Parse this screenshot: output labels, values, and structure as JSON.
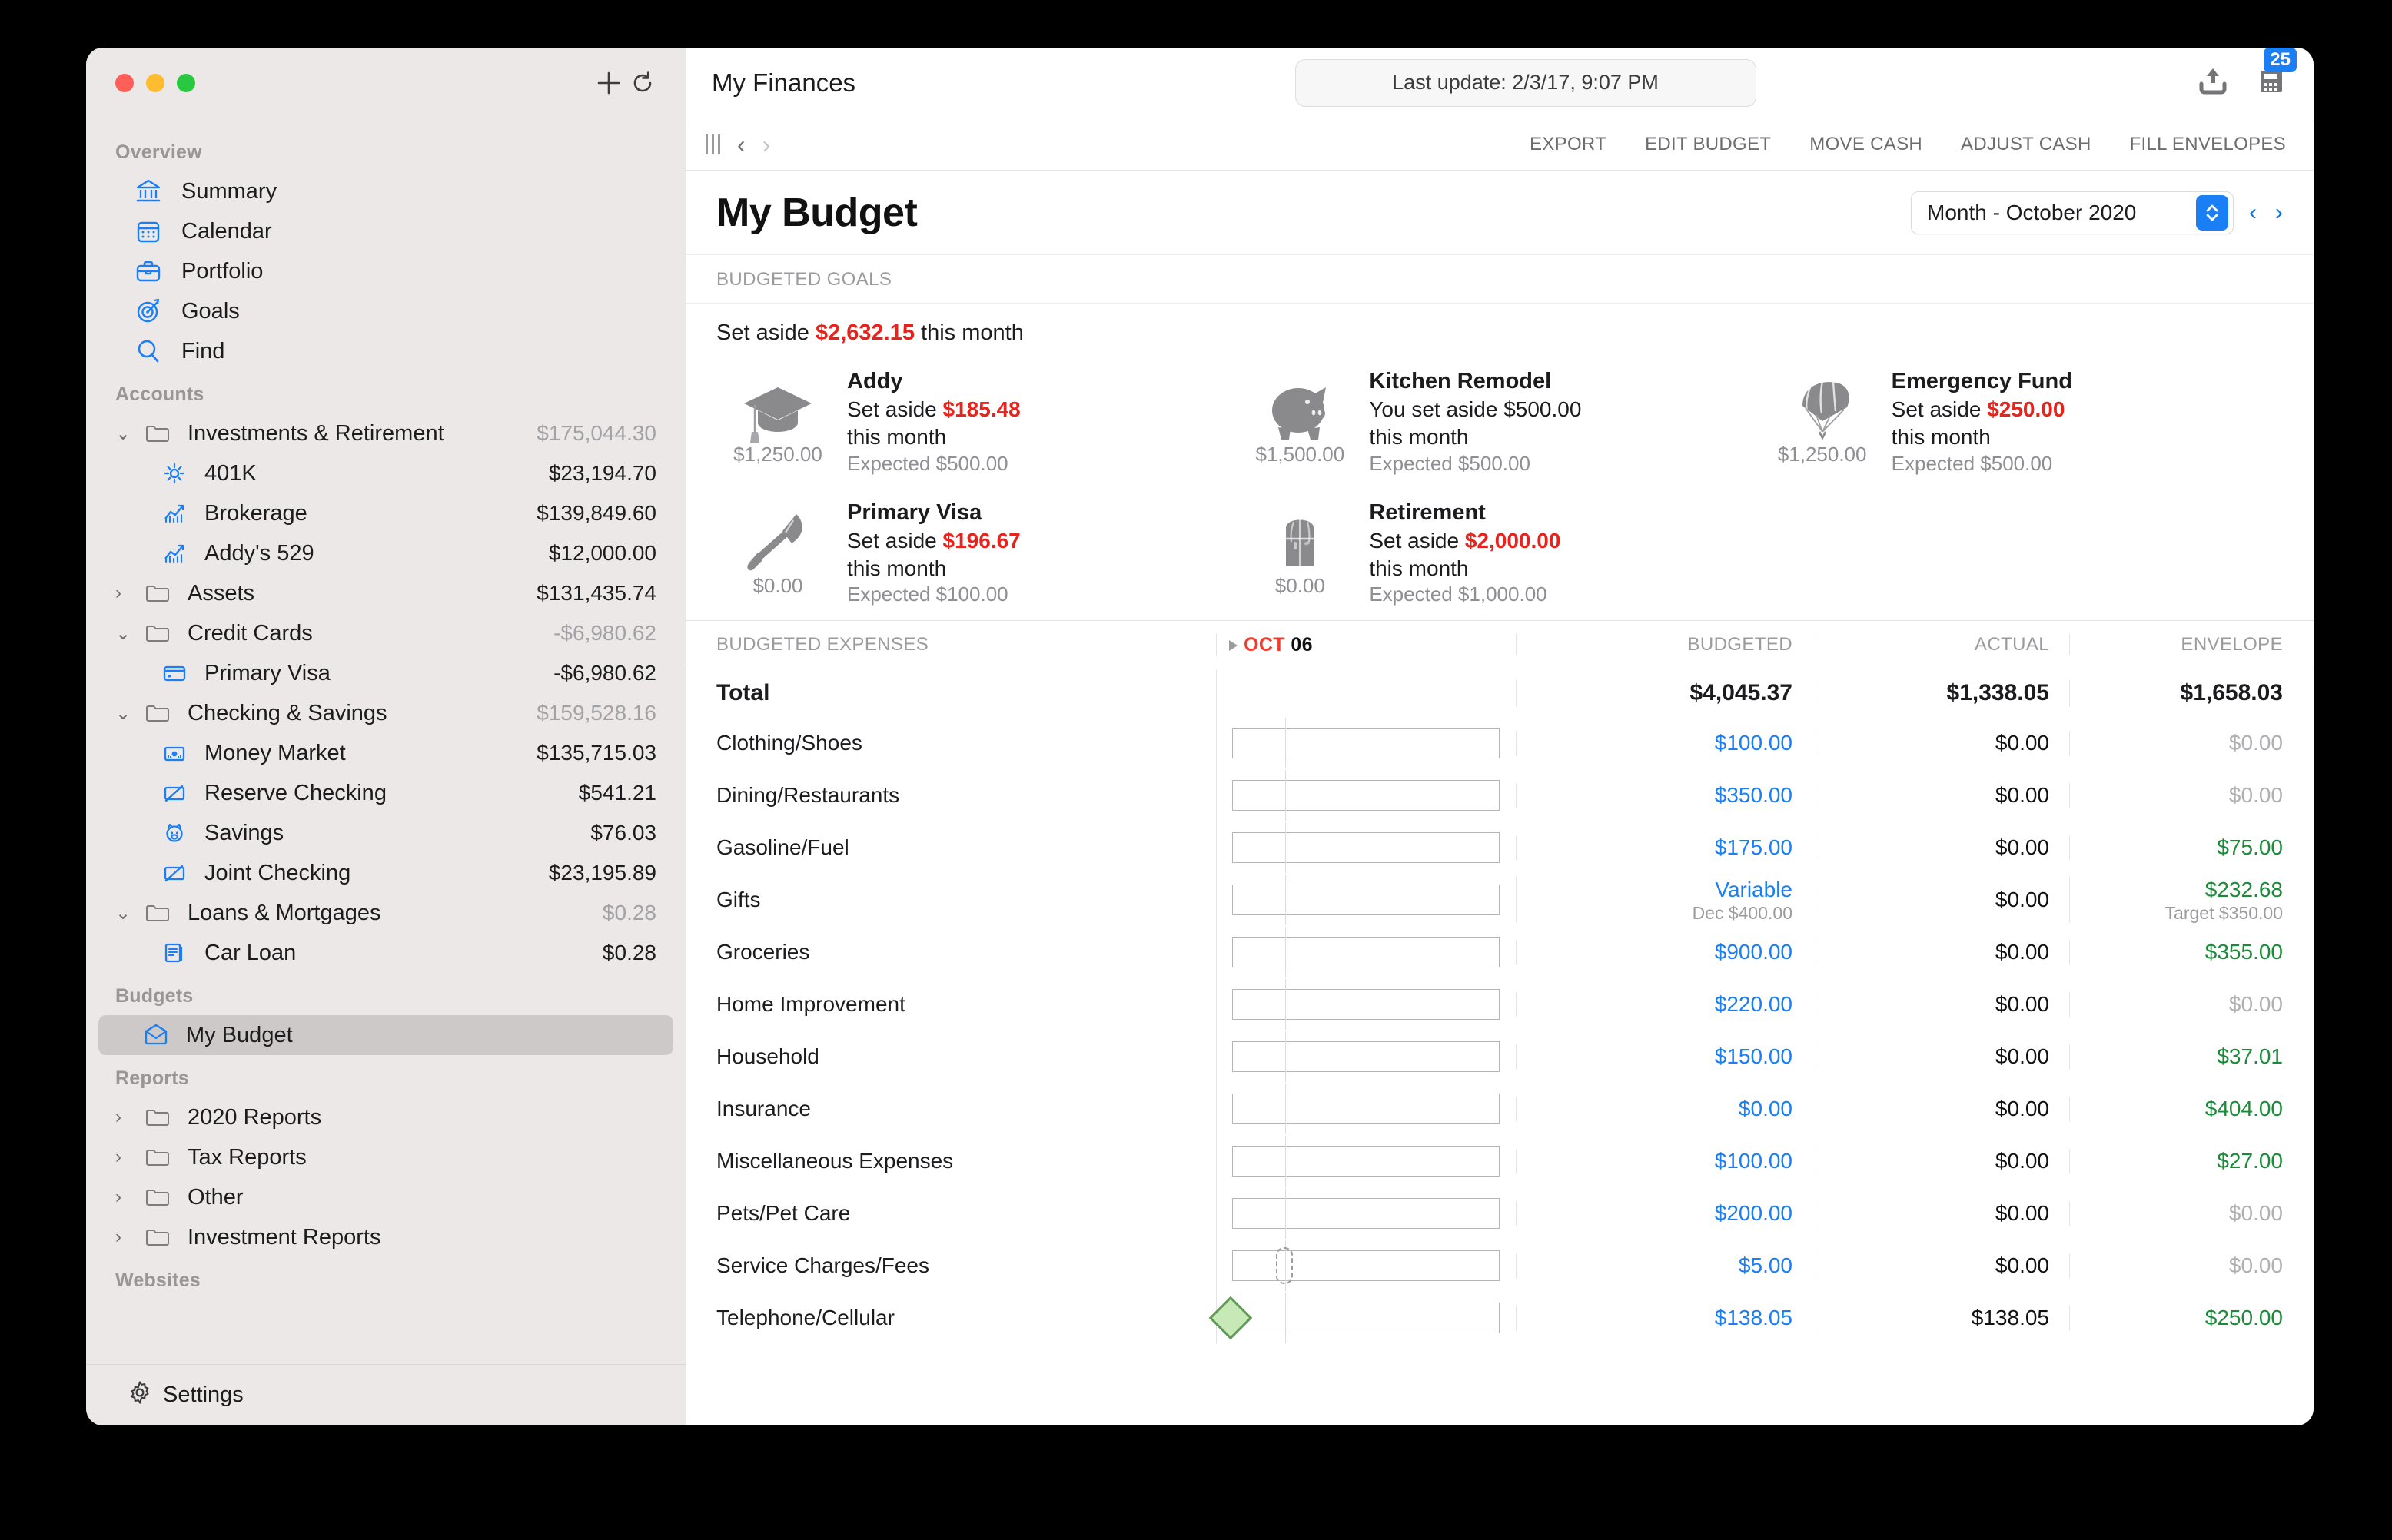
{
  "window": {
    "traffic": [
      "close",
      "minimize",
      "zoom"
    ],
    "sidebar_add_label": "+",
    "sidebar_refresh_label": "refresh"
  },
  "sidebar": {
    "sections": [
      {
        "title": "Overview",
        "items": [
          {
            "label": "Summary",
            "icon": "bank-icon",
            "amount": ""
          },
          {
            "label": "Calendar",
            "icon": "calendar-icon",
            "amount": ""
          },
          {
            "label": "Portfolio",
            "icon": "briefcase-icon",
            "amount": ""
          },
          {
            "label": "Goals",
            "icon": "target-icon",
            "amount": ""
          },
          {
            "label": "Find",
            "icon": "search-icon",
            "amount": ""
          }
        ]
      },
      {
        "title": "Accounts",
        "items": [
          {
            "label": "Investments & Retirement",
            "icon": "folder-icon",
            "amount": "$175,044.30",
            "muted": true,
            "disc": "open",
            "child": false
          },
          {
            "label": "401K",
            "icon": "sun-icon",
            "amount": "$23,194.70",
            "muted": false,
            "disc": "",
            "child": true
          },
          {
            "label": "Brokerage",
            "icon": "chart-up-icon",
            "amount": "$139,849.60",
            "muted": false,
            "disc": "",
            "child": true
          },
          {
            "label": "Addy's 529",
            "icon": "chart-up-icon",
            "amount": "$12,000.00",
            "muted": false,
            "disc": "",
            "child": true
          },
          {
            "label": "Assets",
            "icon": "folder-icon",
            "amount": "$131,435.74",
            "muted": false,
            "disc": "closed",
            "child": false
          },
          {
            "label": "Credit Cards",
            "icon": "folder-icon",
            "amount": "-$6,980.62",
            "muted": true,
            "disc": "open",
            "child": false
          },
          {
            "label": "Primary Visa",
            "icon": "credit-card-icon",
            "amount": "-$6,980.62",
            "muted": false,
            "disc": "",
            "child": true
          },
          {
            "label": "Checking & Savings",
            "icon": "folder-icon",
            "amount": "$159,528.16",
            "muted": true,
            "disc": "open",
            "child": false
          },
          {
            "label": "Money Market",
            "icon": "money-icon",
            "amount": "$135,715.03",
            "muted": false,
            "disc": "",
            "child": true
          },
          {
            "label": "Reserve Checking",
            "icon": "checkbook-icon",
            "amount": "$541.21",
            "muted": false,
            "disc": "",
            "child": true
          },
          {
            "label": "Savings",
            "icon": "piggy-bank-icon",
            "amount": "$76.03",
            "muted": false,
            "disc": "",
            "child": true
          },
          {
            "label": "Joint Checking",
            "icon": "checkbook-icon",
            "amount": "$23,195.89",
            "muted": false,
            "disc": "",
            "child": true
          },
          {
            "label": "Loans & Mortgages",
            "icon": "folder-icon",
            "amount": "$0.28",
            "muted": true,
            "disc": "open",
            "child": false
          },
          {
            "label": "Car Loan",
            "icon": "contract-icon",
            "amount": "$0.28",
            "muted": false,
            "disc": "",
            "child": true
          }
        ]
      },
      {
        "title": "Budgets",
        "items": [
          {
            "label": "My Budget",
            "icon": "envelope-budget-icon",
            "amount": "",
            "selected": true,
            "child": true
          }
        ]
      },
      {
        "title": "Reports",
        "items": [
          {
            "label": "2020 Reports",
            "icon": "folder-icon",
            "amount": "",
            "disc": "closed"
          },
          {
            "label": "Tax Reports",
            "icon": "folder-icon",
            "amount": "",
            "disc": "closed"
          },
          {
            "label": "Other",
            "icon": "folder-icon",
            "amount": "",
            "disc": "closed"
          },
          {
            "label": "Investment Reports",
            "icon": "folder-icon",
            "amount": "",
            "disc": "closed"
          }
        ]
      },
      {
        "title": "Websites",
        "items": []
      }
    ],
    "footer": {
      "label": "Settings",
      "icon": "gear-icon"
    }
  },
  "main": {
    "titlebar": {
      "title": "My Finances",
      "last_update": "Last update: 2/3/17, 9:07 PM",
      "export_icon": "upload-icon",
      "register_icon": "calculator-icon",
      "badge": "25"
    },
    "actionbar": {
      "sidebar_toggle": "sidebar-toggle-icon",
      "back": "‹",
      "forward": "›",
      "actions": [
        "EXPORT",
        "EDIT BUDGET",
        "MOVE CASH",
        "ADJUST CASH",
        "FILL ENVELOPES"
      ]
    },
    "heading": {
      "page_title": "My Budget",
      "period_value": "Month - October 2020",
      "prev": "‹",
      "next": "›"
    },
    "goals_section": {
      "label": "BUDGETED GOALS",
      "summary_prefix": "Set aside ",
      "summary_amount": "$2,632.15",
      "summary_suffix": " this month",
      "items": [
        {
          "name": "Addy",
          "icon": "graduation-cap-icon",
          "balance": "$1,250.00",
          "line_prefix": "Set aside ",
          "line_amount": "$185.48",
          "line_amount_red": true,
          "line_suffix": "",
          "line2": "this month",
          "expected": "Expected $500.00"
        },
        {
          "name": "Kitchen Remodel",
          "icon": "piggy-bank-icon",
          "balance": "$1,500.00",
          "line_prefix": "You set aside ",
          "line_amount": "$500.00",
          "line_amount_red": false,
          "line_suffix": "",
          "line2": "this month",
          "expected": "Expected $500.00"
        },
        {
          "name": "Emergency Fund",
          "icon": "parachute-icon",
          "balance": "$1,250.00",
          "line_prefix": "Set aside ",
          "line_amount": "$250.00",
          "line_amount_red": true,
          "line_suffix": "",
          "line2": "this month",
          "expected": "Expected $500.00"
        },
        {
          "name": "Primary Visa",
          "icon": "shovel-icon",
          "balance": "$0.00",
          "line_prefix": "Set aside ",
          "line_amount": "$196.67",
          "line_amount_red": true,
          "line_suffix": "",
          "line2": "this month",
          "expected": "Expected $100.00"
        },
        {
          "name": "Retirement",
          "icon": "chest-icon",
          "balance": "$0.00",
          "line_prefix": "Set aside ",
          "line_amount": "$2,000.00",
          "line_amount_red": true,
          "line_suffix": "",
          "line2": "this month",
          "expected": "Expected $1,000.00"
        }
      ]
    },
    "expenses_table": {
      "columns": {
        "name": "BUDGETED EXPENSES",
        "date_month": "OCT",
        "date_day": "06",
        "budgeted": "BUDGETED",
        "actual": "ACTUAL",
        "envelope": "ENVELOPE"
      },
      "total_row": {
        "name": "Total",
        "budgeted": "$4,045.37",
        "actual": "$1,338.05",
        "envelope": "$1,658.03"
      },
      "rows": [
        {
          "name": "Clothing/Shoes",
          "budgeted": "$100.00",
          "budgeted_sub": "",
          "actual": "$0.00",
          "envelope": "$0.00",
          "envelope_sub": "",
          "envelope_style": "muted",
          "marker": "none"
        },
        {
          "name": "Dining/Restaurants",
          "budgeted": "$350.00",
          "budgeted_sub": "",
          "actual": "$0.00",
          "envelope": "$0.00",
          "envelope_sub": "",
          "envelope_style": "muted",
          "marker": "none"
        },
        {
          "name": "Gasoline/Fuel",
          "budgeted": "$175.00",
          "budgeted_sub": "",
          "actual": "$0.00",
          "envelope": "$75.00",
          "envelope_sub": "",
          "envelope_style": "pos",
          "marker": "none"
        },
        {
          "name": "Gifts",
          "budgeted": "Variable",
          "budgeted_sub": "Dec $400.00",
          "actual": "$0.00",
          "envelope": "$232.68",
          "envelope_sub": "Target $350.00",
          "envelope_style": "pos",
          "marker": "none"
        },
        {
          "name": "Groceries",
          "budgeted": "$900.00",
          "budgeted_sub": "",
          "actual": "$0.00",
          "envelope": "$355.00",
          "envelope_sub": "",
          "envelope_style": "pos",
          "marker": "none"
        },
        {
          "name": "Home Improvement",
          "budgeted": "$220.00",
          "budgeted_sub": "",
          "actual": "$0.00",
          "envelope": "$0.00",
          "envelope_sub": "",
          "envelope_style": "muted",
          "marker": "none"
        },
        {
          "name": "Household",
          "budgeted": "$150.00",
          "budgeted_sub": "",
          "actual": "$0.00",
          "envelope": "$37.01",
          "envelope_sub": "",
          "envelope_style": "pos",
          "marker": "none"
        },
        {
          "name": "Insurance",
          "budgeted": "$0.00",
          "budgeted_sub": "",
          "actual": "$0.00",
          "envelope": "$404.00",
          "envelope_sub": "",
          "envelope_style": "pos",
          "marker": "none"
        },
        {
          "name": "Miscellaneous Expenses",
          "budgeted": "$100.00",
          "budgeted_sub": "",
          "actual": "$0.00",
          "envelope": "$27.00",
          "envelope_sub": "",
          "envelope_style": "pos",
          "marker": "none"
        },
        {
          "name": "Pets/Pet Care",
          "budgeted": "$200.00",
          "budgeted_sub": "",
          "actual": "$0.00",
          "envelope": "$0.00",
          "envelope_sub": "",
          "envelope_style": "muted",
          "marker": "none"
        },
        {
          "name": "Service Charges/Fees",
          "budgeted": "$5.00",
          "budgeted_sub": "",
          "actual": "$0.00",
          "envelope": "$0.00",
          "envelope_sub": "",
          "envelope_style": "muted",
          "marker": "ghost"
        },
        {
          "name": "Telephone/Cellular",
          "budgeted": "$138.05",
          "budgeted_sub": "",
          "actual": "$138.05",
          "envelope": "$250.00",
          "envelope_sub": "",
          "envelope_style": "pos",
          "marker": "green"
        }
      ]
    }
  },
  "colors": {
    "accent_blue": "#1a7ef5",
    "red": "#e8221c",
    "green": "#1d8a3a",
    "sidebar_bg": "#ece8e7",
    "selected_row": "#cdc9c8"
  }
}
